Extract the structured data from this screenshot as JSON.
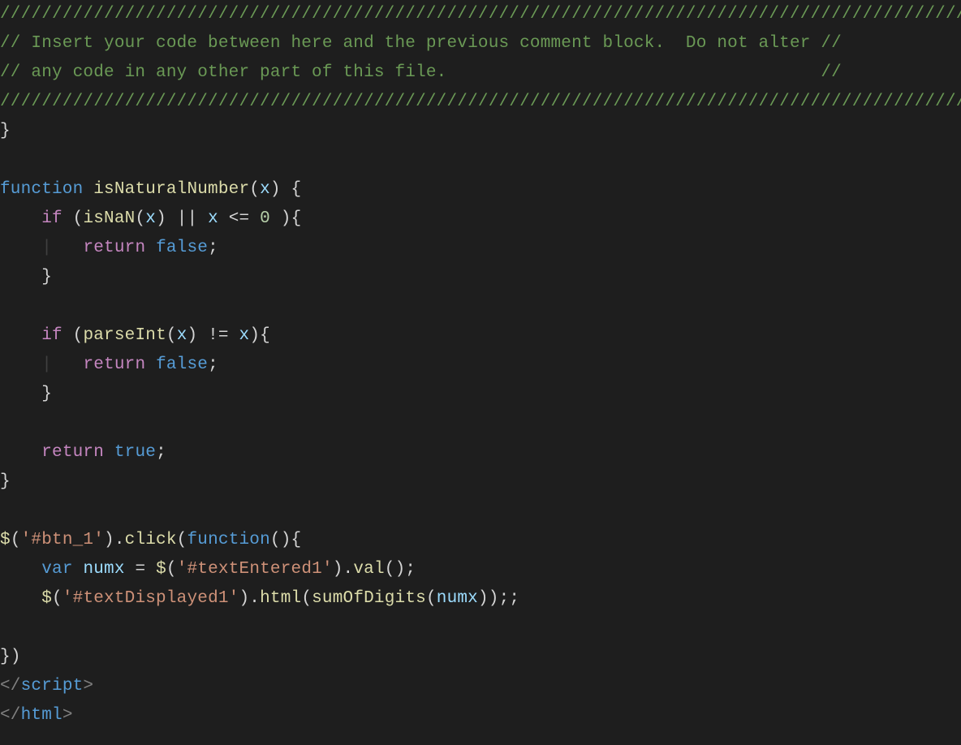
{
  "theme": {
    "background": "#1e1e1e",
    "comment": "#6a9955",
    "keyword": "#569cd6",
    "control": "#c586c0",
    "function": "#dcdcaa",
    "variable": "#9cdcfe",
    "number": "#b5cea8",
    "string": "#ce9178",
    "punct": "#d4d4d4",
    "tagAngle": "#808080",
    "guide": "#404040"
  },
  "lines": [
    [
      {
        "cls": "c-comment",
        "t": "//////////////////////////////////////////////////////////////////////////////////////////////////"
      }
    ],
    [
      {
        "cls": "c-comment",
        "t": "// Insert your code between here and the previous comment block.  Do not alter //"
      }
    ],
    [
      {
        "cls": "c-comment",
        "t": "// any code in any other part of this file.                                    //"
      }
    ],
    [
      {
        "cls": "c-comment",
        "t": "//////////////////////////////////////////////////////////////////////////////////////////////////"
      }
    ],
    [
      {
        "cls": "c-brace",
        "t": "}"
      }
    ],
    [],
    [
      {
        "cls": "c-keyword",
        "t": "function"
      },
      {
        "cls": "c-plain",
        "t": " "
      },
      {
        "cls": "c-funcdecl",
        "t": "isNaturalNumber"
      },
      {
        "cls": "c-punct",
        "t": "("
      },
      {
        "cls": "c-paramname",
        "t": "x"
      },
      {
        "cls": "c-punct",
        "t": ") "
      },
      {
        "cls": "c-brace",
        "t": "{"
      }
    ],
    [
      {
        "cls": "c-plain",
        "t": "    "
      },
      {
        "cls": "c-control",
        "t": "if"
      },
      {
        "cls": "c-plain",
        "t": " "
      },
      {
        "cls": "c-punct",
        "t": "("
      },
      {
        "cls": "c-funccall",
        "t": "isNaN"
      },
      {
        "cls": "c-punct",
        "t": "("
      },
      {
        "cls": "c-varname",
        "t": "x"
      },
      {
        "cls": "c-punct",
        "t": ") "
      },
      {
        "cls": "c-operator",
        "t": "||"
      },
      {
        "cls": "c-plain",
        "t": " "
      },
      {
        "cls": "c-varname",
        "t": "x"
      },
      {
        "cls": "c-plain",
        "t": " "
      },
      {
        "cls": "c-operator",
        "t": "<="
      },
      {
        "cls": "c-plain",
        "t": " "
      },
      {
        "cls": "c-number",
        "t": "0"
      },
      {
        "cls": "c-plain",
        "t": " "
      },
      {
        "cls": "c-punct",
        "t": ")"
      },
      {
        "cls": "c-brace",
        "t": "{"
      }
    ],
    [
      {
        "cls": "c-plain",
        "t": "    "
      },
      {
        "cls": "c-guide",
        "t": "|"
      },
      {
        "cls": "c-plain",
        "t": "   "
      },
      {
        "cls": "c-control",
        "t": "return"
      },
      {
        "cls": "c-plain",
        "t": " "
      },
      {
        "cls": "c-keyword",
        "t": "false"
      },
      {
        "cls": "c-punct",
        "t": ";"
      }
    ],
    [
      {
        "cls": "c-plain",
        "t": "    "
      },
      {
        "cls": "c-brace",
        "t": "}"
      }
    ],
    [],
    [
      {
        "cls": "c-plain",
        "t": "    "
      },
      {
        "cls": "c-control",
        "t": "if"
      },
      {
        "cls": "c-plain",
        "t": " "
      },
      {
        "cls": "c-punct",
        "t": "("
      },
      {
        "cls": "c-funccall",
        "t": "parseInt"
      },
      {
        "cls": "c-punct",
        "t": "("
      },
      {
        "cls": "c-varname",
        "t": "x"
      },
      {
        "cls": "c-punct",
        "t": ") "
      },
      {
        "cls": "c-operator",
        "t": "!="
      },
      {
        "cls": "c-plain",
        "t": " "
      },
      {
        "cls": "c-varname",
        "t": "x"
      },
      {
        "cls": "c-punct",
        "t": ")"
      },
      {
        "cls": "c-brace",
        "t": "{"
      }
    ],
    [
      {
        "cls": "c-plain",
        "t": "    "
      },
      {
        "cls": "c-guide",
        "t": "|"
      },
      {
        "cls": "c-plain",
        "t": "   "
      },
      {
        "cls": "c-control",
        "t": "return"
      },
      {
        "cls": "c-plain",
        "t": " "
      },
      {
        "cls": "c-keyword",
        "t": "false"
      },
      {
        "cls": "c-punct",
        "t": ";"
      }
    ],
    [
      {
        "cls": "c-plain",
        "t": "    "
      },
      {
        "cls": "c-brace",
        "t": "}"
      }
    ],
    [],
    [
      {
        "cls": "c-plain",
        "t": "    "
      },
      {
        "cls": "c-control",
        "t": "return"
      },
      {
        "cls": "c-plain",
        "t": " "
      },
      {
        "cls": "c-keyword",
        "t": "true"
      },
      {
        "cls": "c-punct",
        "t": ";"
      }
    ],
    [
      {
        "cls": "c-brace",
        "t": "}"
      }
    ],
    [],
    [
      {
        "cls": "c-funccall",
        "t": "$"
      },
      {
        "cls": "c-punct",
        "t": "("
      },
      {
        "cls": "c-string",
        "t": "'#btn_1'"
      },
      {
        "cls": "c-punct",
        "t": ")."
      },
      {
        "cls": "c-funccall",
        "t": "click"
      },
      {
        "cls": "c-punct",
        "t": "("
      },
      {
        "cls": "c-keyword",
        "t": "function"
      },
      {
        "cls": "c-punct",
        "t": "()"
      },
      {
        "cls": "c-brace",
        "t": "{"
      }
    ],
    [
      {
        "cls": "c-plain",
        "t": "    "
      },
      {
        "cls": "c-keyword",
        "t": "var"
      },
      {
        "cls": "c-plain",
        "t": " "
      },
      {
        "cls": "c-varname",
        "t": "numx"
      },
      {
        "cls": "c-plain",
        "t": " "
      },
      {
        "cls": "c-operator",
        "t": "="
      },
      {
        "cls": "c-plain",
        "t": " "
      },
      {
        "cls": "c-funccall",
        "t": "$"
      },
      {
        "cls": "c-punct",
        "t": "("
      },
      {
        "cls": "c-string",
        "t": "'#textEntered1'"
      },
      {
        "cls": "c-punct",
        "t": ")."
      },
      {
        "cls": "c-funccall",
        "t": "val"
      },
      {
        "cls": "c-punct",
        "t": "();"
      }
    ],
    [
      {
        "cls": "c-plain",
        "t": "    "
      },
      {
        "cls": "c-funccall",
        "t": "$"
      },
      {
        "cls": "c-punct",
        "t": "("
      },
      {
        "cls": "c-string",
        "t": "'#textDisplayed1'"
      },
      {
        "cls": "c-punct",
        "t": ")."
      },
      {
        "cls": "c-funccall",
        "t": "html"
      },
      {
        "cls": "c-punct",
        "t": "("
      },
      {
        "cls": "c-funccall",
        "t": "sumOfDigits"
      },
      {
        "cls": "c-punct",
        "t": "("
      },
      {
        "cls": "c-varname",
        "t": "numx"
      },
      {
        "cls": "c-punct",
        "t": "));;"
      }
    ],
    [],
    [
      {
        "cls": "c-brace",
        "t": "}"
      },
      {
        "cls": "c-punct",
        "t": ")"
      }
    ],
    [
      {
        "cls": "c-tagangle",
        "t": "</"
      },
      {
        "cls": "c-tagname",
        "t": "script"
      },
      {
        "cls": "c-tagangle",
        "t": ">"
      }
    ],
    [
      {
        "cls": "c-tagangle",
        "t": "</"
      },
      {
        "cls": "c-tagname",
        "t": "html"
      },
      {
        "cls": "c-tagangle",
        "t": ">"
      }
    ]
  ]
}
